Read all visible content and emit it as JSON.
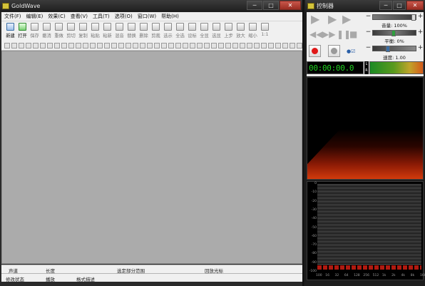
{
  "main_window": {
    "title": "GoldWave",
    "controls": {
      "minimize": "─",
      "maximize": "□",
      "close": "✕"
    }
  },
  "menu": [
    "文件(F)",
    "编辑(E)",
    "效果(C)",
    "查看(V)",
    "工具(T)",
    "选项(O)",
    "窗口(W)",
    "帮助(H)"
  ],
  "toolbar": {
    "buttons": [
      "新建",
      "打开",
      "保存",
      "撤消",
      "重做",
      "剪切",
      "复制",
      "粘贴",
      "粘新",
      "混音",
      "替换",
      "删除",
      "剪裁",
      "选示",
      "全选",
      "设标",
      "全显",
      "选显",
      "上步",
      "放大",
      "缩小",
      "1:1"
    ]
  },
  "status": {
    "row1": {
      "channel": "声道",
      "length": "长度",
      "selection": "选定部分范围",
      "cursor": "回放光标"
    },
    "row2": {
      "modified": "修改状态",
      "play": "播放",
      "format": "格式描述"
    }
  },
  "controller": {
    "title": "控制器",
    "controls": {
      "minimize": "─",
      "maximize": "□",
      "close": "✕"
    },
    "volume_label": "音量: 100%",
    "balance_label": "平衡: 0%",
    "speed_label": "速度: 1.00",
    "time": "00:00:00.0",
    "lr": {
      "l": "L",
      "r": "R"
    },
    "accent": "#21d321"
  },
  "spectrum": {
    "y_labels": [
      "0",
      "-10",
      "-20",
      "-30",
      "-40",
      "-50",
      "-60",
      "-70",
      "-80",
      "-90",
      "-100"
    ],
    "x_labels": [
      "100",
      "16",
      "32",
      "64",
      "128",
      "256",
      "512",
      "1k",
      "2k",
      "4k",
      "8k",
      "16k"
    ]
  }
}
